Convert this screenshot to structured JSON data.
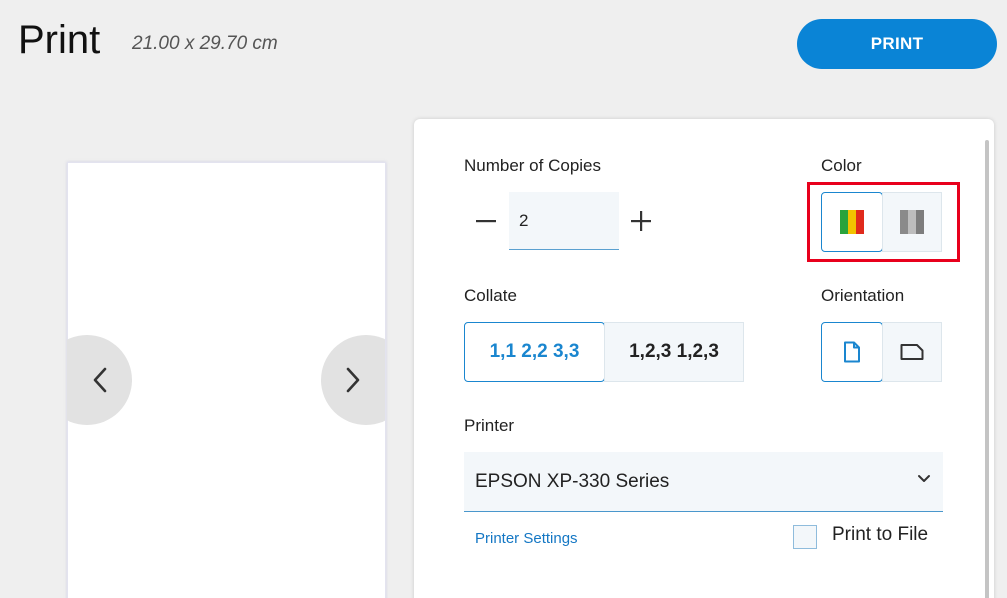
{
  "header": {
    "title": "Print",
    "paper_size": "21.00 x 29.70 cm",
    "print_button": "PRINT"
  },
  "preview": {
    "prev_icon": "chevron-left-icon",
    "next_icon": "chevron-right-icon"
  },
  "copies": {
    "label": "Number of Copies",
    "value": "2",
    "decrement_icon": "minus-icon",
    "increment_icon": "plus-icon"
  },
  "color": {
    "label": "Color",
    "options": [
      {
        "name": "color",
        "icon": "color-bars-icon",
        "selected": true
      },
      {
        "name": "grayscale",
        "icon": "grayscale-bars-icon",
        "selected": false
      }
    ]
  },
  "collate": {
    "label": "Collate",
    "options": [
      {
        "label": "1,1 2,2 3,3",
        "selected": true
      },
      {
        "label": "1,2,3 1,2,3",
        "selected": false
      }
    ]
  },
  "orientation": {
    "label": "Orientation",
    "options": [
      {
        "name": "portrait",
        "icon": "portrait-page-icon",
        "selected": true
      },
      {
        "name": "landscape",
        "icon": "landscape-page-icon",
        "selected": false
      }
    ]
  },
  "printer": {
    "label": "Printer",
    "selected": "EPSON XP-330 Series",
    "settings_link": "Printer Settings",
    "print_to_file_label": "Print to File",
    "print_to_file_checked": false
  },
  "colors": {
    "accent": "#0a84d6",
    "selected_border": "#1a86cf",
    "highlight": "#e8001c",
    "background": "#efefef"
  }
}
